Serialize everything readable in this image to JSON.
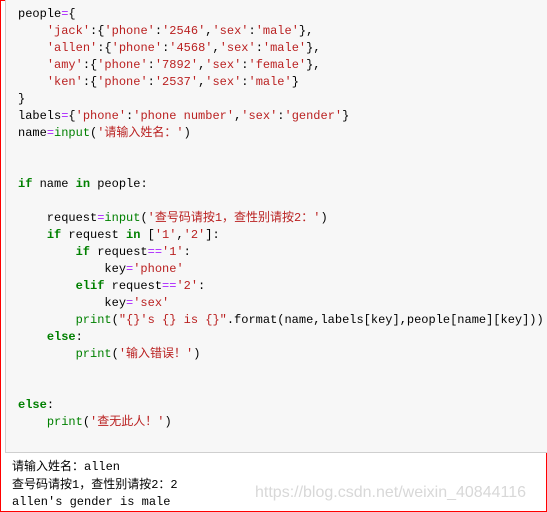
{
  "code_lines": [
    [
      [
        "n",
        "people"
      ],
      [
        "o",
        "="
      ],
      [
        "n",
        "{"
      ]
    ],
    [
      [
        "n",
        "    "
      ],
      [
        "s",
        "'jack'"
      ],
      [
        "n",
        ":{"
      ],
      [
        "s",
        "'phone'"
      ],
      [
        "n",
        ":"
      ],
      [
        "s",
        "'2546'"
      ],
      [
        "n",
        ","
      ],
      [
        "s",
        "'sex'"
      ],
      [
        "n",
        ":"
      ],
      [
        "s",
        "'male'"
      ],
      [
        "n",
        "},"
      ]
    ],
    [
      [
        "n",
        "    "
      ],
      [
        "s",
        "'allen'"
      ],
      [
        "n",
        ":{"
      ],
      [
        "s",
        "'phone'"
      ],
      [
        "n",
        ":"
      ],
      [
        "s",
        "'4568'"
      ],
      [
        "n",
        ","
      ],
      [
        "s",
        "'sex'"
      ],
      [
        "n",
        ":"
      ],
      [
        "s",
        "'male'"
      ],
      [
        "n",
        "},"
      ]
    ],
    [
      [
        "n",
        "    "
      ],
      [
        "s",
        "'amy'"
      ],
      [
        "n",
        ":{"
      ],
      [
        "s",
        "'phone'"
      ],
      [
        "n",
        ":"
      ],
      [
        "s",
        "'7892'"
      ],
      [
        "n",
        ","
      ],
      [
        "s",
        "'sex'"
      ],
      [
        "n",
        ":"
      ],
      [
        "s",
        "'female'"
      ],
      [
        "n",
        "},"
      ]
    ],
    [
      [
        "n",
        "    "
      ],
      [
        "s",
        "'ken'"
      ],
      [
        "n",
        ":{"
      ],
      [
        "s",
        "'phone'"
      ],
      [
        "n",
        ":"
      ],
      [
        "s",
        "'2537'"
      ],
      [
        "n",
        ","
      ],
      [
        "s",
        "'sex'"
      ],
      [
        "n",
        ":"
      ],
      [
        "s",
        "'male'"
      ],
      [
        "n",
        "}"
      ]
    ],
    [
      [
        "n",
        "}"
      ]
    ],
    [
      [
        "n",
        "labels"
      ],
      [
        "o",
        "="
      ],
      [
        "n",
        "{"
      ],
      [
        "s",
        "'phone'"
      ],
      [
        "n",
        ":"
      ],
      [
        "s",
        "'phone number'"
      ],
      [
        "n",
        ","
      ],
      [
        "s",
        "'sex'"
      ],
      [
        "n",
        ":"
      ],
      [
        "s",
        "'gender'"
      ],
      [
        "n",
        "}"
      ]
    ],
    [
      [
        "n",
        "name"
      ],
      [
        "o",
        "="
      ],
      [
        "b",
        "input"
      ],
      [
        "n",
        "("
      ],
      [
        "s",
        "'请输入姓名：'"
      ],
      [
        "n",
        ")"
      ]
    ],
    [],
    [],
    [
      [
        "k",
        "if"
      ],
      [
        "n",
        " name "
      ],
      [
        "k",
        "in"
      ],
      [
        "n",
        " people:"
      ]
    ],
    [],
    [
      [
        "n",
        "    request"
      ],
      [
        "o",
        "="
      ],
      [
        "b",
        "input"
      ],
      [
        "n",
        "("
      ],
      [
        "s",
        "'查号码请按1，查性别请按2：'"
      ],
      [
        "n",
        ")"
      ]
    ],
    [
      [
        "n",
        "    "
      ],
      [
        "k",
        "if"
      ],
      [
        "n",
        " request "
      ],
      [
        "k",
        "in"
      ],
      [
        "n",
        " ["
      ],
      [
        "s",
        "'1'"
      ],
      [
        "n",
        ","
      ],
      [
        "s",
        "'2'"
      ],
      [
        "n",
        "]:"
      ]
    ],
    [
      [
        "n",
        "        "
      ],
      [
        "k",
        "if"
      ],
      [
        "n",
        " request"
      ],
      [
        "o",
        "=="
      ],
      [
        "s",
        "'1'"
      ],
      [
        "n",
        ":"
      ]
    ],
    [
      [
        "n",
        "            key"
      ],
      [
        "o",
        "="
      ],
      [
        "s",
        "'phone'"
      ]
    ],
    [
      [
        "n",
        "        "
      ],
      [
        "k",
        "elif"
      ],
      [
        "n",
        " request"
      ],
      [
        "o",
        "=="
      ],
      [
        "s",
        "'2'"
      ],
      [
        "n",
        ":"
      ]
    ],
    [
      [
        "n",
        "            key"
      ],
      [
        "o",
        "="
      ],
      [
        "s",
        "'sex'"
      ]
    ],
    [
      [
        "n",
        "        "
      ],
      [
        "b",
        "print"
      ],
      [
        "n",
        "("
      ],
      [
        "s",
        "\"{}'s {} is {}\""
      ],
      [
        "n",
        ".format(name,labels[key],people[name][key]))"
      ]
    ],
    [
      [
        "n",
        "    "
      ],
      [
        "k",
        "else"
      ],
      [
        "n",
        ":"
      ]
    ],
    [
      [
        "n",
        "        "
      ],
      [
        "b",
        "print"
      ],
      [
        "n",
        "("
      ],
      [
        "s",
        "'输入错误！'"
      ],
      [
        "n",
        ")"
      ]
    ],
    [],
    [],
    [
      [
        "k",
        "else"
      ],
      [
        "n",
        ":"
      ]
    ],
    [
      [
        "n",
        "    "
      ],
      [
        "b",
        "print"
      ],
      [
        "n",
        "("
      ],
      [
        "s",
        "'查无此人！'"
      ],
      [
        "n",
        ")"
      ]
    ]
  ],
  "output_lines": [
    "请输入姓名：allen",
    "查号码请按1，查性别请按2：2",
    "allen's gender is male"
  ],
  "watermark": "https://blog.csdn.net/weixin_40844116",
  "colors": {
    "keyword": "#008000",
    "string": "#ba2121",
    "operator": "#aa22ff",
    "builtin": "#008000",
    "border": "#ff0000",
    "cell_bg": "#f7f7f7"
  }
}
